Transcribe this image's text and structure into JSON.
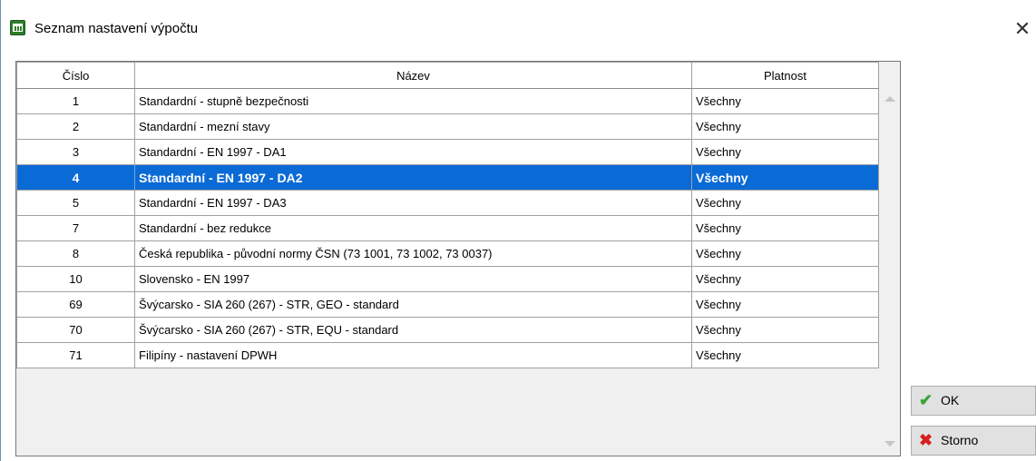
{
  "window": {
    "title": "Seznam nastavení výpočtu",
    "close_symbol": "✕"
  },
  "table": {
    "headers": [
      "Číslo",
      "Název",
      "Platnost"
    ],
    "rows": [
      {
        "num": "1",
        "name": "Standardní - stupně bezpečnosti",
        "validity": "Všechny"
      },
      {
        "num": "2",
        "name": "Standardní - mezní stavy",
        "validity": "Všechny"
      },
      {
        "num": "3",
        "name": "Standardní - EN 1997 - DA1",
        "validity": "Všechny"
      },
      {
        "num": "4",
        "name": "Standardní - EN 1997 - DA2",
        "validity": "Všechny"
      },
      {
        "num": "5",
        "name": "Standardní - EN 1997 - DA3",
        "validity": "Všechny"
      },
      {
        "num": "7",
        "name": "Standardní - bez redukce",
        "validity": "Všechny"
      },
      {
        "num": "8",
        "name": "Česká republika - původní normy ČSN (73 1001, 73 1002, 73 0037)",
        "validity": "Všechny"
      },
      {
        "num": "10",
        "name": "Slovensko - EN 1997",
        "validity": "Všechny"
      },
      {
        "num": "69",
        "name": "Švýcarsko - SIA 260 (267) - STR, GEO - standard",
        "validity": "Všechny"
      },
      {
        "num": "70",
        "name": "Švýcarsko - SIA 260 (267) - STR, EQU - standard",
        "validity": "Všechny"
      },
      {
        "num": "71",
        "name": "Filipíny - nastavení DPWH",
        "validity": "Všechny"
      }
    ],
    "selected_row": "4"
  },
  "buttons": {
    "ok_label": "OK",
    "cancel_label": "Storno"
  },
  "icons": {
    "app": "app-icon",
    "ok": "checkmark-icon",
    "cancel": "cross-icon"
  },
  "colors": {
    "selection": "#0a6ad6",
    "ok_icon": "#3aa335",
    "cancel_icon": "#d62020"
  }
}
